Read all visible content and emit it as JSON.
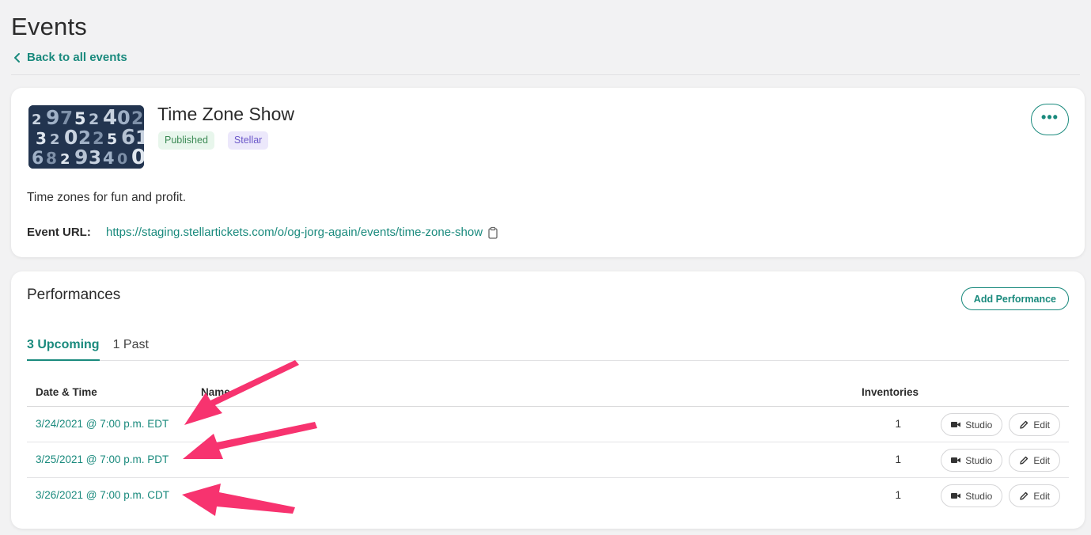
{
  "header": {
    "title": "Events",
    "back_label": "Back to all events"
  },
  "event": {
    "title": "Time Zone Show",
    "badges": [
      "Published",
      "Stellar"
    ],
    "more_label": "•••",
    "description": "Time zones for fun and profit.",
    "url_label": "Event URL:",
    "url": "https://staging.stellartickets.com/o/og-jorg-again/events/time-zone-show"
  },
  "performances": {
    "heading": "Performances",
    "add_button": "Add Performance",
    "tabs": [
      {
        "label": "3 Upcoming",
        "active": true
      },
      {
        "label": "1 Past",
        "active": false
      }
    ],
    "columns": {
      "date": "Date & Time",
      "name": "Name",
      "inventories": "Inventories"
    },
    "rows": [
      {
        "date": "3/24/2021 @ 7:00 p.m. EDT",
        "inventories": "1",
        "studio": "Studio",
        "edit": "Edit"
      },
      {
        "date": "3/25/2021 @ 7:00 p.m. PDT",
        "inventories": "1",
        "studio": "Studio",
        "edit": "Edit"
      },
      {
        "date": "3/26/2021 @ 7:00 p.m. CDT",
        "inventories": "1",
        "studio": "Studio",
        "edit": "Edit"
      }
    ]
  },
  "colors": {
    "accent": "#1a8a7d",
    "annotation_arrow": "#f7336f",
    "background": "#f2f2f3"
  },
  "thumbnail_digits": [
    "2",
    "9",
    "7",
    "5",
    "2",
    "4",
    "0",
    "2",
    "3",
    "2",
    "0",
    "2",
    "2",
    "5",
    "6",
    "1",
    "6",
    "8",
    "2",
    "9",
    "3",
    "4",
    "0",
    "0"
  ]
}
